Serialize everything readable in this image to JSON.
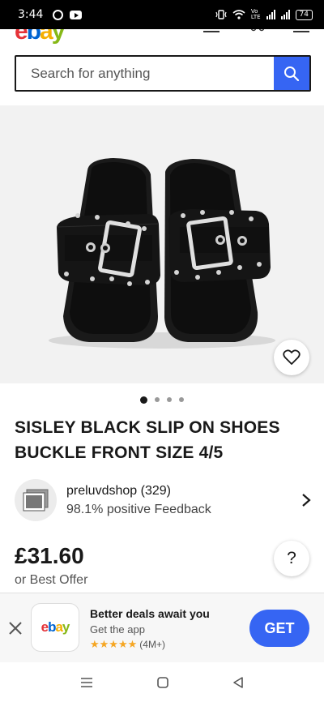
{
  "status_bar": {
    "time": "3:44",
    "battery": "74",
    "icons": [
      "whatsapp-icon",
      "youtube-icon",
      "vibrate-icon",
      "wifi-icon",
      "volte-icon",
      "signal-icon",
      "battery-icon"
    ]
  },
  "search": {
    "placeholder": "Search for anything"
  },
  "listing": {
    "title": "SISLEY BLACK SLIP ON SHOES BUCKLE FRONT SIZE 4/5",
    "image_count": 4,
    "active_image_index": 0,
    "price": "£31.60",
    "best_offer": "or Best Offer"
  },
  "seller": {
    "name": "preluvdshop (329)",
    "feedback": "98.1% positive Feedback"
  },
  "app_banner": {
    "title": "Better deals await you",
    "subtitle": "Get the app",
    "rating_count": "(4M+)",
    "stars": "★★★★★",
    "app_name": "ebay",
    "get_label": "GET"
  },
  "help_label": "?",
  "colors": {
    "brand_blue": "#3665f3",
    "ebay_red": "#e53238",
    "ebay_blue": "#0064d2",
    "ebay_yellow": "#f5af02",
    "ebay_green": "#86b817",
    "star": "#f5a623"
  }
}
